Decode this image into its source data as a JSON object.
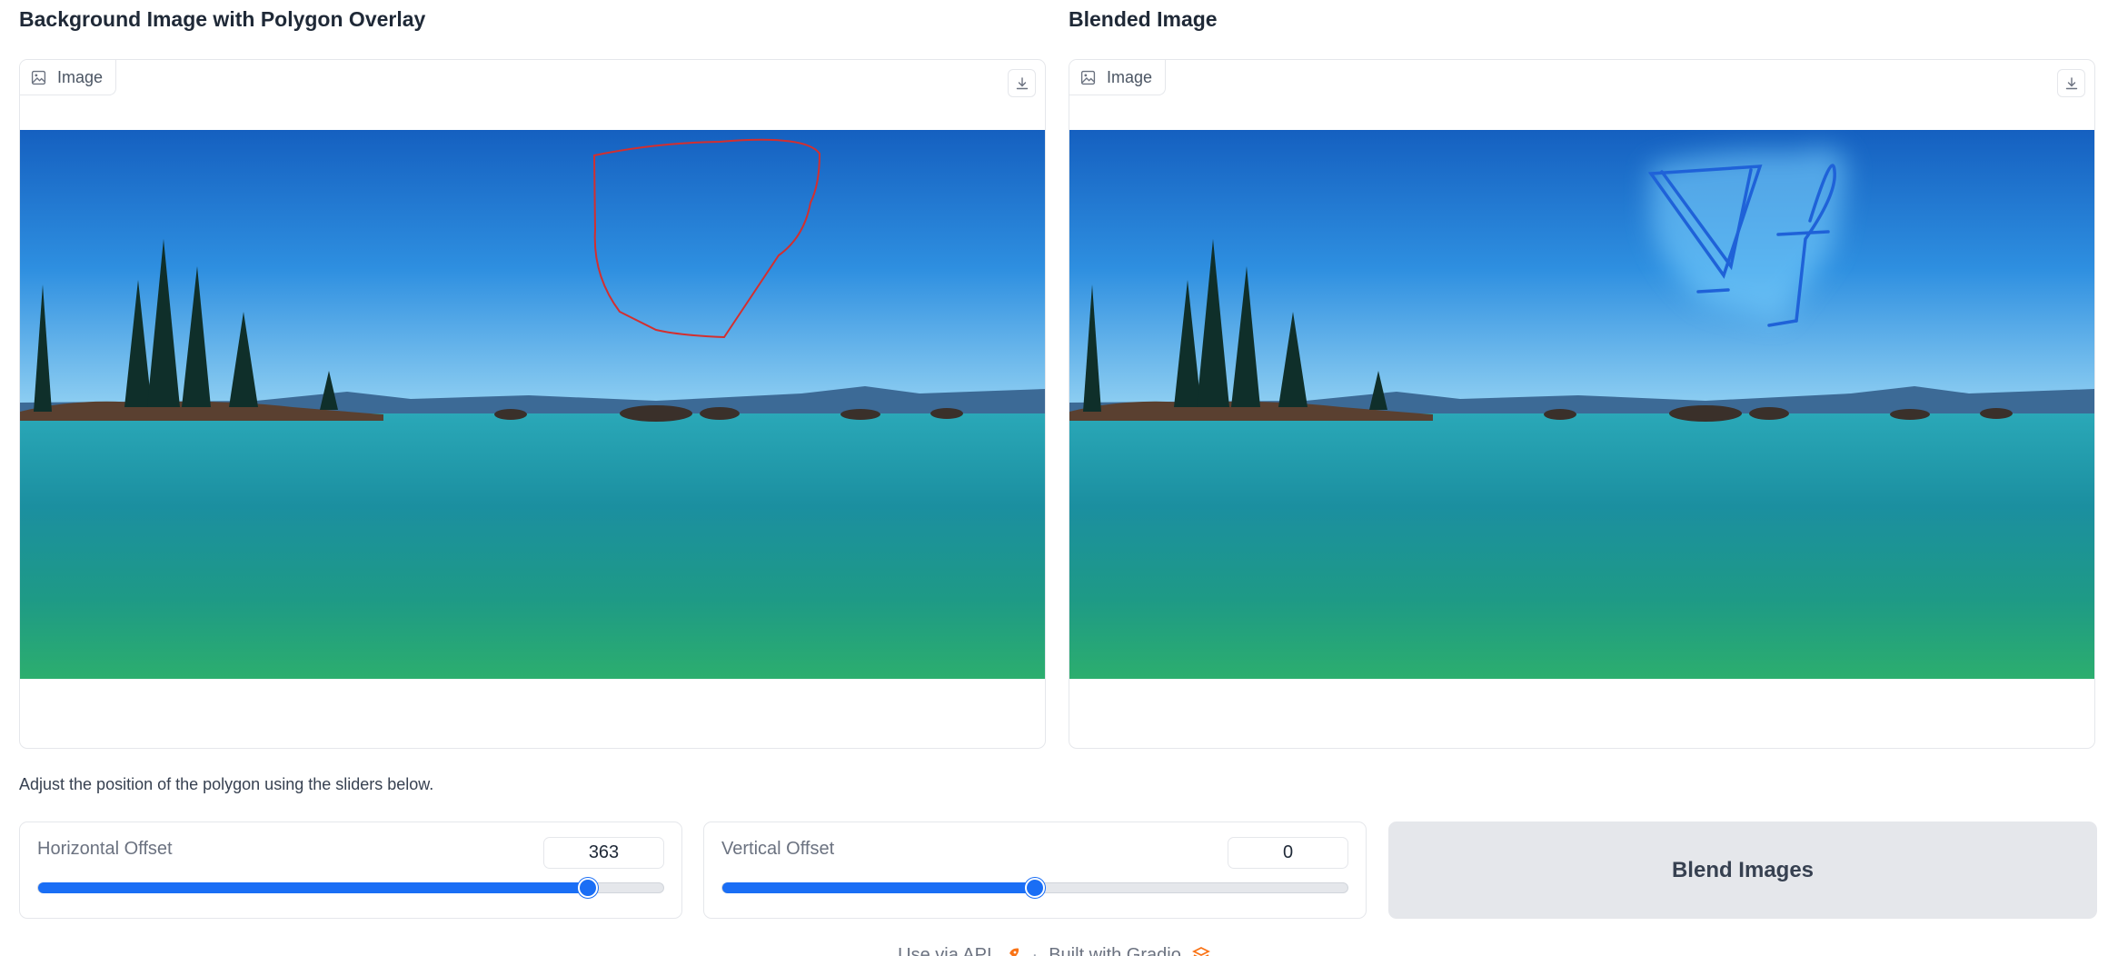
{
  "left_panel": {
    "heading": "Background Image with Polygon Overlay",
    "label": "Image"
  },
  "right_panel": {
    "heading": "Blended Image",
    "label": "Image"
  },
  "instructions": "Adjust the position of the polygon using the sliders below.",
  "sliders": {
    "horizontal": {
      "label": "Horizontal Offset",
      "value": "363",
      "fraction": 0.88
    },
    "vertical": {
      "label": "Vertical Offset",
      "value": "0",
      "fraction": 0.5
    }
  },
  "blend_button": {
    "label": "Blend Images"
  },
  "footer": {
    "api": "Use via API",
    "separator": "·",
    "built": "Built with Gradio"
  },
  "colors": {
    "accent": "#1a6ef5",
    "polygon": "#d32f2f",
    "button_bg": "#e5e7eb"
  },
  "icons": [
    "image-icon",
    "download-icon",
    "rocket-icon",
    "gradio-logo-icon"
  ]
}
